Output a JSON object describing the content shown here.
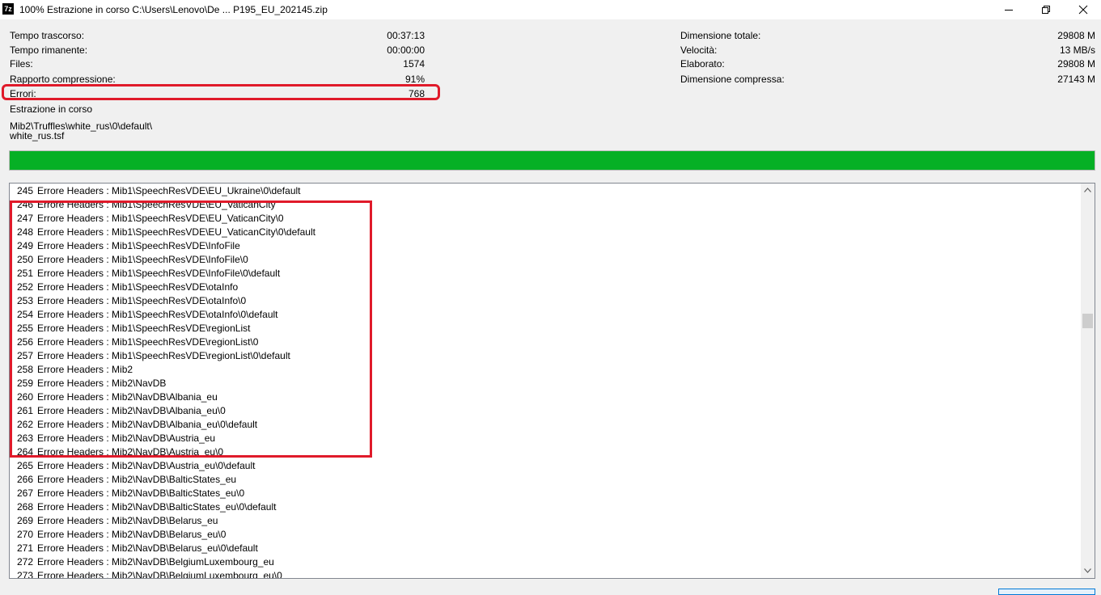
{
  "window": {
    "title": "100% Estrazione in corso C:\\Users\\Lenovo\\De ... P195_EU_202145.zip",
    "icon_label": "7z",
    "icons": {
      "minimize": "minimize-icon",
      "maximize": "restore-icon",
      "close": "close-icon"
    }
  },
  "stats_left": [
    {
      "label": "Tempo trascorso:",
      "value": "00:37:13"
    },
    {
      "label": "Tempo rimanente:",
      "value": "00:00:00"
    },
    {
      "label": "Files:",
      "value": "1574"
    },
    {
      "label": "Rapporto compressione:",
      "value": "91%"
    },
    {
      "label": "Errori:",
      "value": "768"
    }
  ],
  "stats_right": [
    {
      "label": "Dimensione totale:",
      "value": "29808 M"
    },
    {
      "label": "Velocità:",
      "value": "13 MB/s"
    },
    {
      "label": "Elaborato:",
      "value": "29808 M"
    },
    {
      "label": "Dimensione compressa:",
      "value": "27143 M"
    }
  ],
  "status": {
    "label": "Estrazione in corso",
    "path": "Mib2\\Truffles\\white_rus\\0\\default\\",
    "file": "white_rus.tsf"
  },
  "progress": {
    "fraction": 1.0,
    "color": "#06b025"
  },
  "log": [
    {
      "n": "245",
      "msg": "Errore Headers : Mib1\\SpeechResVDE\\EU_Ukraine\\0\\default"
    },
    {
      "n": "246",
      "msg": "Errore Headers : Mib1\\SpeechResVDE\\EU_VaticanCity"
    },
    {
      "n": "247",
      "msg": "Errore Headers : Mib1\\SpeechResVDE\\EU_VaticanCity\\0"
    },
    {
      "n": "248",
      "msg": "Errore Headers : Mib1\\SpeechResVDE\\EU_VaticanCity\\0\\default"
    },
    {
      "n": "249",
      "msg": "Errore Headers : Mib1\\SpeechResVDE\\InfoFile"
    },
    {
      "n": "250",
      "msg": "Errore Headers : Mib1\\SpeechResVDE\\InfoFile\\0"
    },
    {
      "n": "251",
      "msg": "Errore Headers : Mib1\\SpeechResVDE\\InfoFile\\0\\default"
    },
    {
      "n": "252",
      "msg": "Errore Headers : Mib1\\SpeechResVDE\\otaInfo"
    },
    {
      "n": "253",
      "msg": "Errore Headers : Mib1\\SpeechResVDE\\otaInfo\\0"
    },
    {
      "n": "254",
      "msg": "Errore Headers : Mib1\\SpeechResVDE\\otaInfo\\0\\default"
    },
    {
      "n": "255",
      "msg": "Errore Headers : Mib1\\SpeechResVDE\\regionList"
    },
    {
      "n": "256",
      "msg": "Errore Headers : Mib1\\SpeechResVDE\\regionList\\0"
    },
    {
      "n": "257",
      "msg": "Errore Headers : Mib1\\SpeechResVDE\\regionList\\0\\default"
    },
    {
      "n": "258",
      "msg": "Errore Headers : Mib2"
    },
    {
      "n": "259",
      "msg": "Errore Headers : Mib2\\NavDB"
    },
    {
      "n": "260",
      "msg": "Errore Headers : Mib2\\NavDB\\Albania_eu"
    },
    {
      "n": "261",
      "msg": "Errore Headers : Mib2\\NavDB\\Albania_eu\\0"
    },
    {
      "n": "262",
      "msg": "Errore Headers : Mib2\\NavDB\\Albania_eu\\0\\default"
    },
    {
      "n": "263",
      "msg": "Errore Headers : Mib2\\NavDB\\Austria_eu"
    },
    {
      "n": "264",
      "msg": "Errore Headers : Mib2\\NavDB\\Austria_eu\\0"
    },
    {
      "n": "265",
      "msg": "Errore Headers : Mib2\\NavDB\\Austria_eu\\0\\default"
    },
    {
      "n": "266",
      "msg": "Errore Headers : Mib2\\NavDB\\BalticStates_eu"
    },
    {
      "n": "267",
      "msg": "Errore Headers : Mib2\\NavDB\\BalticStates_eu\\0"
    },
    {
      "n": "268",
      "msg": "Errore Headers : Mib2\\NavDB\\BalticStates_eu\\0\\default"
    },
    {
      "n": "269",
      "msg": "Errore Headers : Mib2\\NavDB\\Belarus_eu"
    },
    {
      "n": "270",
      "msg": "Errore Headers : Mib2\\NavDB\\Belarus_eu\\0"
    },
    {
      "n": "271",
      "msg": "Errore Headers : Mib2\\NavDB\\Belarus_eu\\0\\default"
    },
    {
      "n": "272",
      "msg": "Errore Headers : Mib2\\NavDB\\BelgiumLuxembourg_eu"
    },
    {
      "n": "273",
      "msg": "Errore Headers : Mib2\\NavDB\\BelgiumLuxembourg_eu\\0"
    }
  ],
  "scrollbar": {
    "up_icon": "chevron-up-icon",
    "down_icon": "chevron-down-icon",
    "position_fraction": 0.33
  },
  "annotations": {
    "color": "#e01a2a"
  }
}
